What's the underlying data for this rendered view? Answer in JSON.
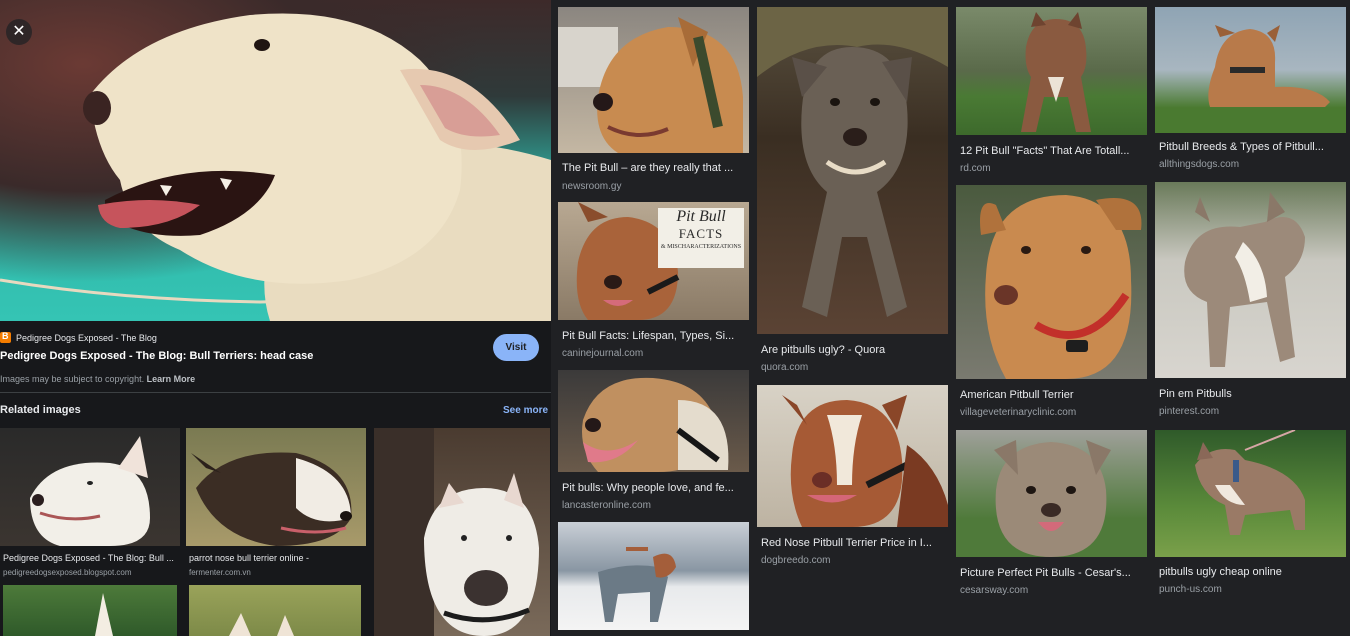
{
  "preview": {
    "close_icon": "close-icon",
    "source_icon": "blogger-icon",
    "source_name": "Pedigree Dogs Exposed - The Blog",
    "title": "Pedigree Dogs Exposed - The Blog: Bull Terriers: head case",
    "visit_label": "Visit",
    "copyright_text": "Images may be subject to copyright.",
    "learn_more": "Learn More",
    "related_heading": "Related images",
    "see_more": "See more",
    "related": [
      {
        "caption": "Pedigree Dogs Exposed - The Blog: Bull ...",
        "source": "pedigreedogsexposed.blogspot.com"
      },
      {
        "caption": "parrot nose bull terrier online -",
        "source": "fermenter.com.vn"
      }
    ]
  },
  "results": [
    {
      "title": "The Pit Bull – are they really that ...",
      "source": "newsroom.gy"
    },
    {
      "title": "Pit Bull Facts: Lifespan, Types, Si...",
      "source": "caninejournal.com",
      "overlay": {
        "line1": "Pit Bull",
        "line2": "FACTS",
        "line3": "& MISCHARACTERIZATIONS"
      }
    },
    {
      "title": "Pit bulls: Why people love, and fe...",
      "source": "lancasteronline.com"
    },
    {
      "title": "Are pitbulls ugly? - Quora",
      "source": "quora.com"
    },
    {
      "title": "Red Nose Pitbull Terrier Price in I...",
      "source": "dogbreedo.com"
    },
    {
      "title": "12 Pit Bull \"Facts\" That Are Totall...",
      "source": "rd.com"
    },
    {
      "title": "American Pitbull Terrier",
      "source": "villageveterinaryclinic.com"
    },
    {
      "title": "Picture Perfect Pit Bulls - Cesar's...",
      "source": "cesarsway.com"
    },
    {
      "title": "Pitbull Breeds & Types of Pitbull...",
      "source": "allthingsdogs.com"
    },
    {
      "title": "Pin em Pitbulls",
      "source": "pinterest.com"
    },
    {
      "title": "pitbulls ugly cheap online",
      "source": "punch-us.com"
    }
  ],
  "colors": {
    "link": "#8ab4f8",
    "visit_bg": "#8ab4f8",
    "background": "#202124",
    "panel": "#17181b"
  }
}
